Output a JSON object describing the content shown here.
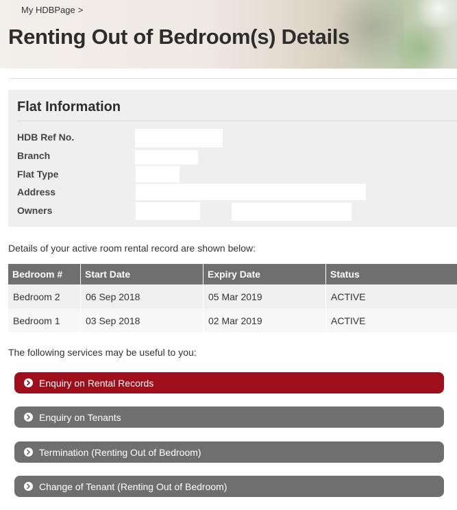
{
  "header": {
    "breadcrumb": "My HDBPage",
    "breadcrumb_sep": ">",
    "title": "Renting Out of Bedroom(s) Details"
  },
  "flat_info": {
    "heading": "Flat Information",
    "labels": {
      "ref_no": "HDB Ref No.",
      "branch": "Branch",
      "flat_type": "Flat Type",
      "address": "Address",
      "owners": "Owners"
    }
  },
  "rental": {
    "intro": "Details of your active room rental record are shown below:",
    "columns": [
      "Bedroom #",
      "Start Date",
      "Expiry Date",
      "Status"
    ],
    "rows": [
      [
        "Bedroom 2",
        "06 Sep 2018",
        "05 Mar 2019",
        "ACTIVE"
      ],
      [
        "Bedroom 1",
        "03 Sep 2018",
        "02 Mar 2019",
        "ACTIVE"
      ]
    ]
  },
  "services": {
    "intro": "The following services may be useful to you:",
    "items": [
      {
        "label": "Enquiry on Rental Records",
        "icon": "chevron-right-circle-icon"
      },
      {
        "label": "Enquiry on Tenants",
        "icon": "chevron-right-circle-icon"
      },
      {
        "label": "Termination (Renting Out of Bedroom)",
        "icon": "chevron-right-circle-icon"
      },
      {
        "label": "Change of Tenant (Renting Out of Bedroom)",
        "icon": "chevron-right-circle-icon"
      }
    ]
  },
  "colors": {
    "accent_red": "#9e0e1b",
    "header_grey": "#6f6f6f",
    "panel_grey": "#efefef"
  }
}
